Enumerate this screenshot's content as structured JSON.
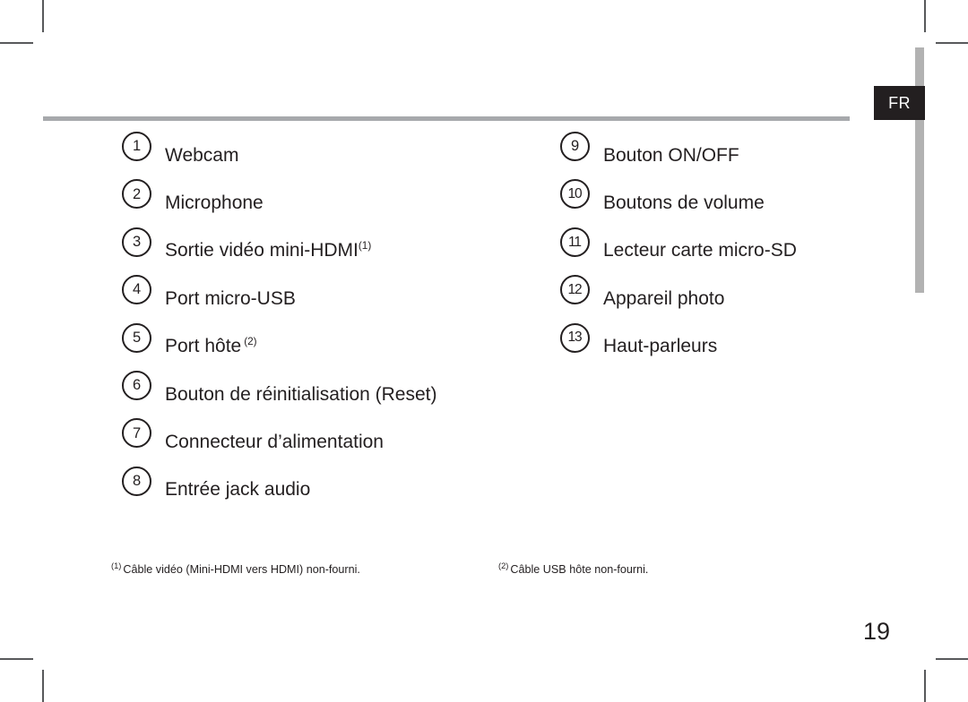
{
  "page": {
    "language_tab": "FR",
    "page_number": "19"
  },
  "left_column": [
    {
      "number": "1",
      "label": "Webcam",
      "footnote_ref": "",
      "footnote_spaced": false
    },
    {
      "number": "2",
      "label": "Microphone",
      "footnote_ref": "",
      "footnote_spaced": false
    },
    {
      "number": "3",
      "label": "Sortie vidéo mini-HDMI",
      "footnote_ref": "(1)",
      "footnote_spaced": false
    },
    {
      "number": "4",
      "label": "Port micro-USB",
      "footnote_ref": "",
      "footnote_spaced": false
    },
    {
      "number": "5",
      "label": "Port hôte",
      "footnote_ref": "(2)",
      "footnote_spaced": true
    },
    {
      "number": "6",
      "label": "Bouton de réinitialisation (Reset)",
      "footnote_ref": "",
      "footnote_spaced": false
    },
    {
      "number": "7",
      "label": "Connecteur d’alimentation",
      "footnote_ref": "",
      "footnote_spaced": false
    },
    {
      "number": "8",
      "label": "Entrée jack audio",
      "footnote_ref": "",
      "footnote_spaced": false
    }
  ],
  "right_column": [
    {
      "number": "9",
      "label": "Bouton ON/OFF"
    },
    {
      "number": "10",
      "label": "Boutons de volume"
    },
    {
      "number": "11",
      "label": "Lecteur carte micro-SD"
    },
    {
      "number": "12",
      "label": "Appareil photo"
    },
    {
      "number": "13",
      "label": "Haut-parleurs"
    }
  ],
  "footnotes": [
    {
      "marker": "(1)",
      "text": "Câble vidéo (Mini-HDMI vers HDMI) non-fourni."
    },
    {
      "marker": "(2)",
      "text": "Câble USB hôte non-fourni."
    }
  ],
  "colors": {
    "text": "#231f20",
    "rule": "#a7a9ac",
    "tab_background": "#231f20",
    "tab_text": "#ffffff",
    "lang_bar": "#b2b2b2",
    "crop_mark": "#58595b"
  }
}
